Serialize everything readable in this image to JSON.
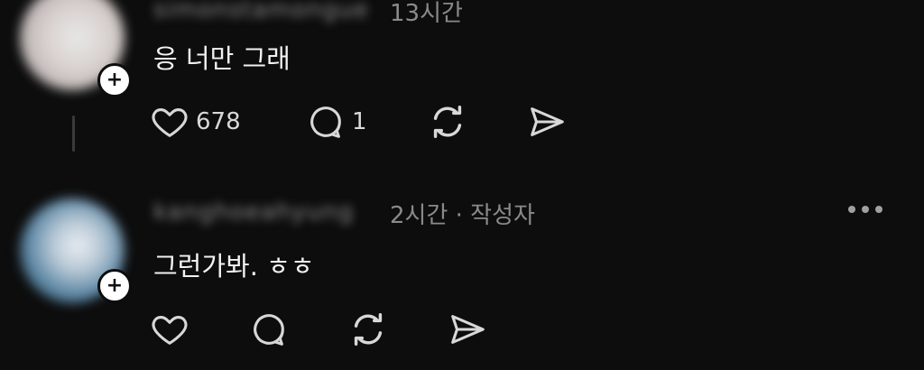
{
  "posts": [
    {
      "username": "simonstamongue",
      "meta": "13시간",
      "text": "응 너만 그래",
      "likes": "678",
      "replies": "1",
      "follow_glyph": "+"
    },
    {
      "username": "kanghoeahyung",
      "meta": "2시간 · 작성자",
      "text": "그런가봐. ㅎㅎ",
      "follow_glyph": "+"
    }
  ],
  "colors": {
    "background": "#0d0d0d",
    "text": "#f2f2f2",
    "muted": "#8a8a8a",
    "like_red": "#ff2d46"
  },
  "icons": [
    "heart-icon",
    "comment-icon",
    "repost-icon",
    "share-icon",
    "more-icon",
    "threads-logo-icon"
  ]
}
